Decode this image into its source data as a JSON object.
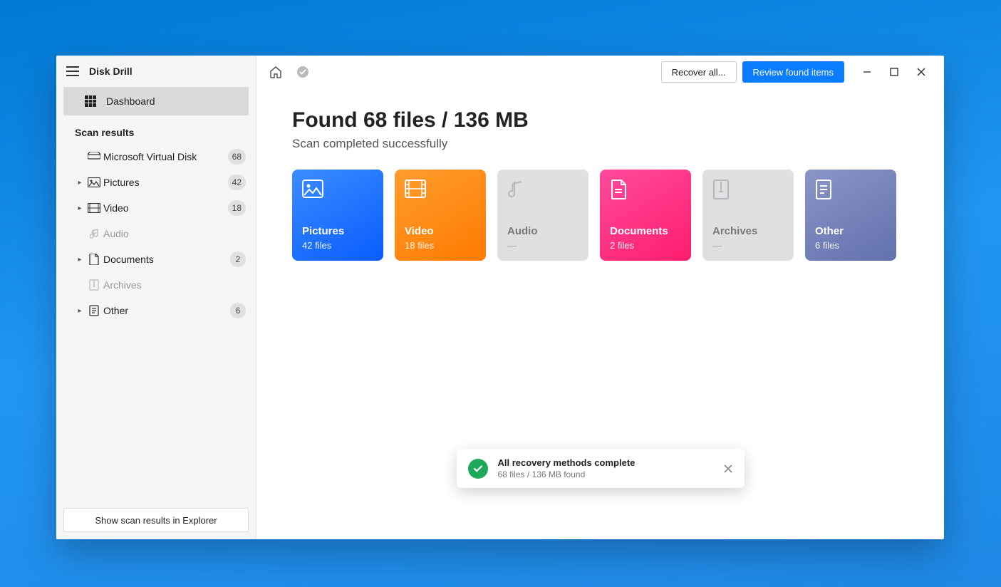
{
  "app": {
    "title": "Disk Drill"
  },
  "sidebar": {
    "dashboard": "Dashboard",
    "section": "Scan results",
    "items": [
      {
        "label": "Microsoft Virtual Disk",
        "badge": "68",
        "has_chevron": false,
        "icon": "disk"
      },
      {
        "label": "Pictures",
        "badge": "42",
        "has_chevron": true,
        "icon": "pictures"
      },
      {
        "label": "Video",
        "badge": "18",
        "has_chevron": true,
        "icon": "video"
      },
      {
        "label": "Audio",
        "badge": "",
        "has_chevron": false,
        "icon": "audio"
      },
      {
        "label": "Documents",
        "badge": "2",
        "has_chevron": true,
        "icon": "documents"
      },
      {
        "label": "Archives",
        "badge": "",
        "has_chevron": false,
        "icon": "archives"
      },
      {
        "label": "Other",
        "badge": "6",
        "has_chevron": true,
        "icon": "other"
      }
    ],
    "footer_button": "Show scan results in Explorer"
  },
  "toolbar": {
    "recover_label": "Recover all...",
    "review_label": "Review found items"
  },
  "main": {
    "heading": "Found 68 files / 136 MB",
    "subheading": "Scan completed successfully",
    "cards": {
      "pictures": {
        "title": "Pictures",
        "sub": "42 files"
      },
      "video": {
        "title": "Video",
        "sub": "18 files"
      },
      "audio": {
        "title": "Audio",
        "sub": "—"
      },
      "documents": {
        "title": "Documents",
        "sub": "2 files"
      },
      "archives": {
        "title": "Archives",
        "sub": "—"
      },
      "other": {
        "title": "Other",
        "sub": "6 files"
      }
    }
  },
  "toast": {
    "title": "All recovery methods complete",
    "subtitle": "68 files / 136 MB found"
  }
}
